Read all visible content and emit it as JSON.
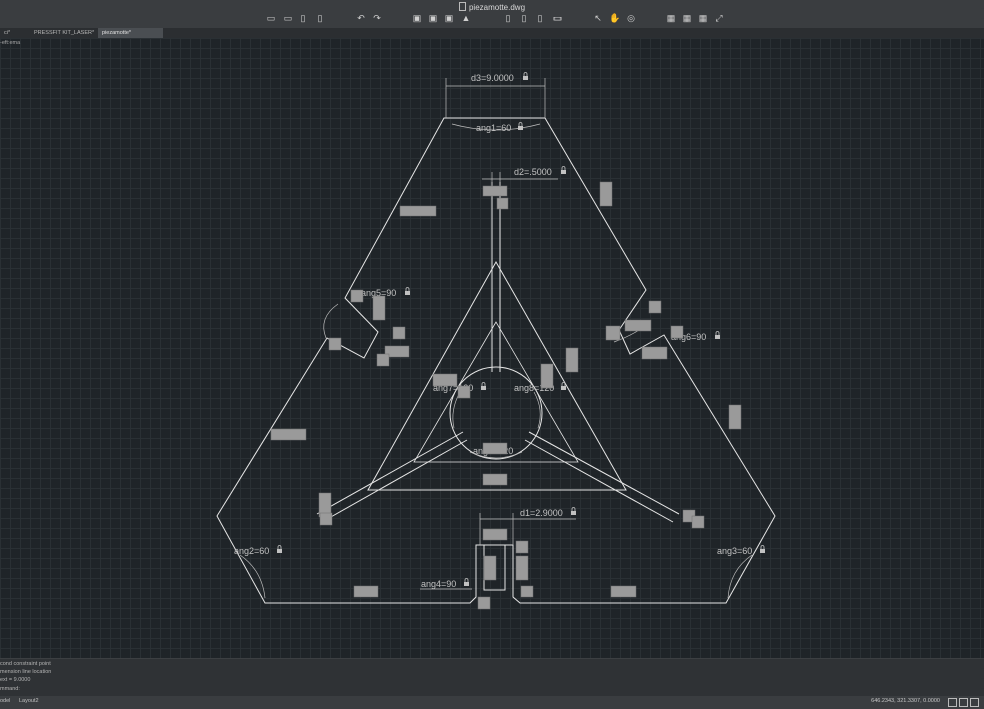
{
  "window": {
    "title": "piezamotte.dwg"
  },
  "toolbar": {
    "buttons": [
      {
        "name": "new-icon",
        "glyph": "▭"
      },
      {
        "name": "open-icon",
        "glyph": "▭"
      },
      {
        "name": "save-icon",
        "glyph": "▯"
      },
      {
        "name": "save-as-icon",
        "glyph": "▯"
      },
      {
        "name": "undo-icon",
        "glyph": "↶"
      },
      {
        "name": "redo-icon",
        "glyph": "↷"
      },
      {
        "name": "print-icon",
        "glyph": "▣"
      },
      {
        "name": "plot-icon",
        "glyph": "▣"
      },
      {
        "name": "print-preview-icon",
        "glyph": "▣"
      },
      {
        "name": "publish-icon",
        "glyph": "▲"
      },
      {
        "name": "export-icon",
        "glyph": "▯"
      },
      {
        "name": "share-icon",
        "glyph": "▯"
      },
      {
        "name": "attach-icon",
        "glyph": "▯"
      },
      {
        "name": "layer-icon",
        "glyph": "▭"
      },
      {
        "name": "properties-icon",
        "glyph": "▭"
      },
      {
        "name": "select-icon",
        "glyph": "↖"
      },
      {
        "name": "pan-icon",
        "glyph": "✋"
      },
      {
        "name": "orbit-icon",
        "glyph": "◎"
      },
      {
        "name": "tool-palette-icon",
        "glyph": "▦"
      },
      {
        "name": "markup-icon",
        "glyph": "▦"
      },
      {
        "name": "sheet-set-icon",
        "glyph": "▦"
      },
      {
        "name": "fullscreen-icon",
        "glyph": "⤢"
      }
    ]
  },
  "tabs": [
    {
      "label": "ci*",
      "active": false
    },
    {
      "label": "PRESSFIT KIT_LASER*",
      "active": false
    },
    {
      "label": "piezamotte*",
      "active": true
    }
  ],
  "viewport": {
    "label": "-eft:ema"
  },
  "dimensions": [
    {
      "name": "dim-d3",
      "text": "d3=9.0000"
    },
    {
      "name": "dim-ang1",
      "text": "ang1=60"
    },
    {
      "name": "dim-d2",
      "text": "d2=.5000"
    },
    {
      "name": "dim-ang5",
      "text": "ang5=90"
    },
    {
      "name": "dim-ang6",
      "text": "ang6=90"
    },
    {
      "name": "dim-ang7",
      "text": "ang7=120"
    },
    {
      "name": "dim-ang8",
      "text": "ang8=120"
    },
    {
      "name": "dim-ang9",
      "text": "ang9=120"
    },
    {
      "name": "dim-d1",
      "text": "d1=2.9000"
    },
    {
      "name": "dim-ang2",
      "text": "ang2=60"
    },
    {
      "name": "dim-ang3",
      "text": "ang3=60"
    },
    {
      "name": "dim-ang4",
      "text": "ang4=90"
    }
  ],
  "command_line": {
    "lines": [
      "cond constraint point",
      "mension line location",
      "ext = 9.0000",
      "mmand:"
    ]
  },
  "statusbar": {
    "layout_tabs": [
      "odel",
      "Layout2"
    ],
    "coordinates": "646.2343, 321.3307, 0.0000"
  },
  "colors": {
    "background": "#1f2428",
    "linework": "#e6e6e6",
    "dimension": "#c2c2c2",
    "constraint_badge": "#9a9a9a",
    "chrome": "#3a3d40"
  }
}
